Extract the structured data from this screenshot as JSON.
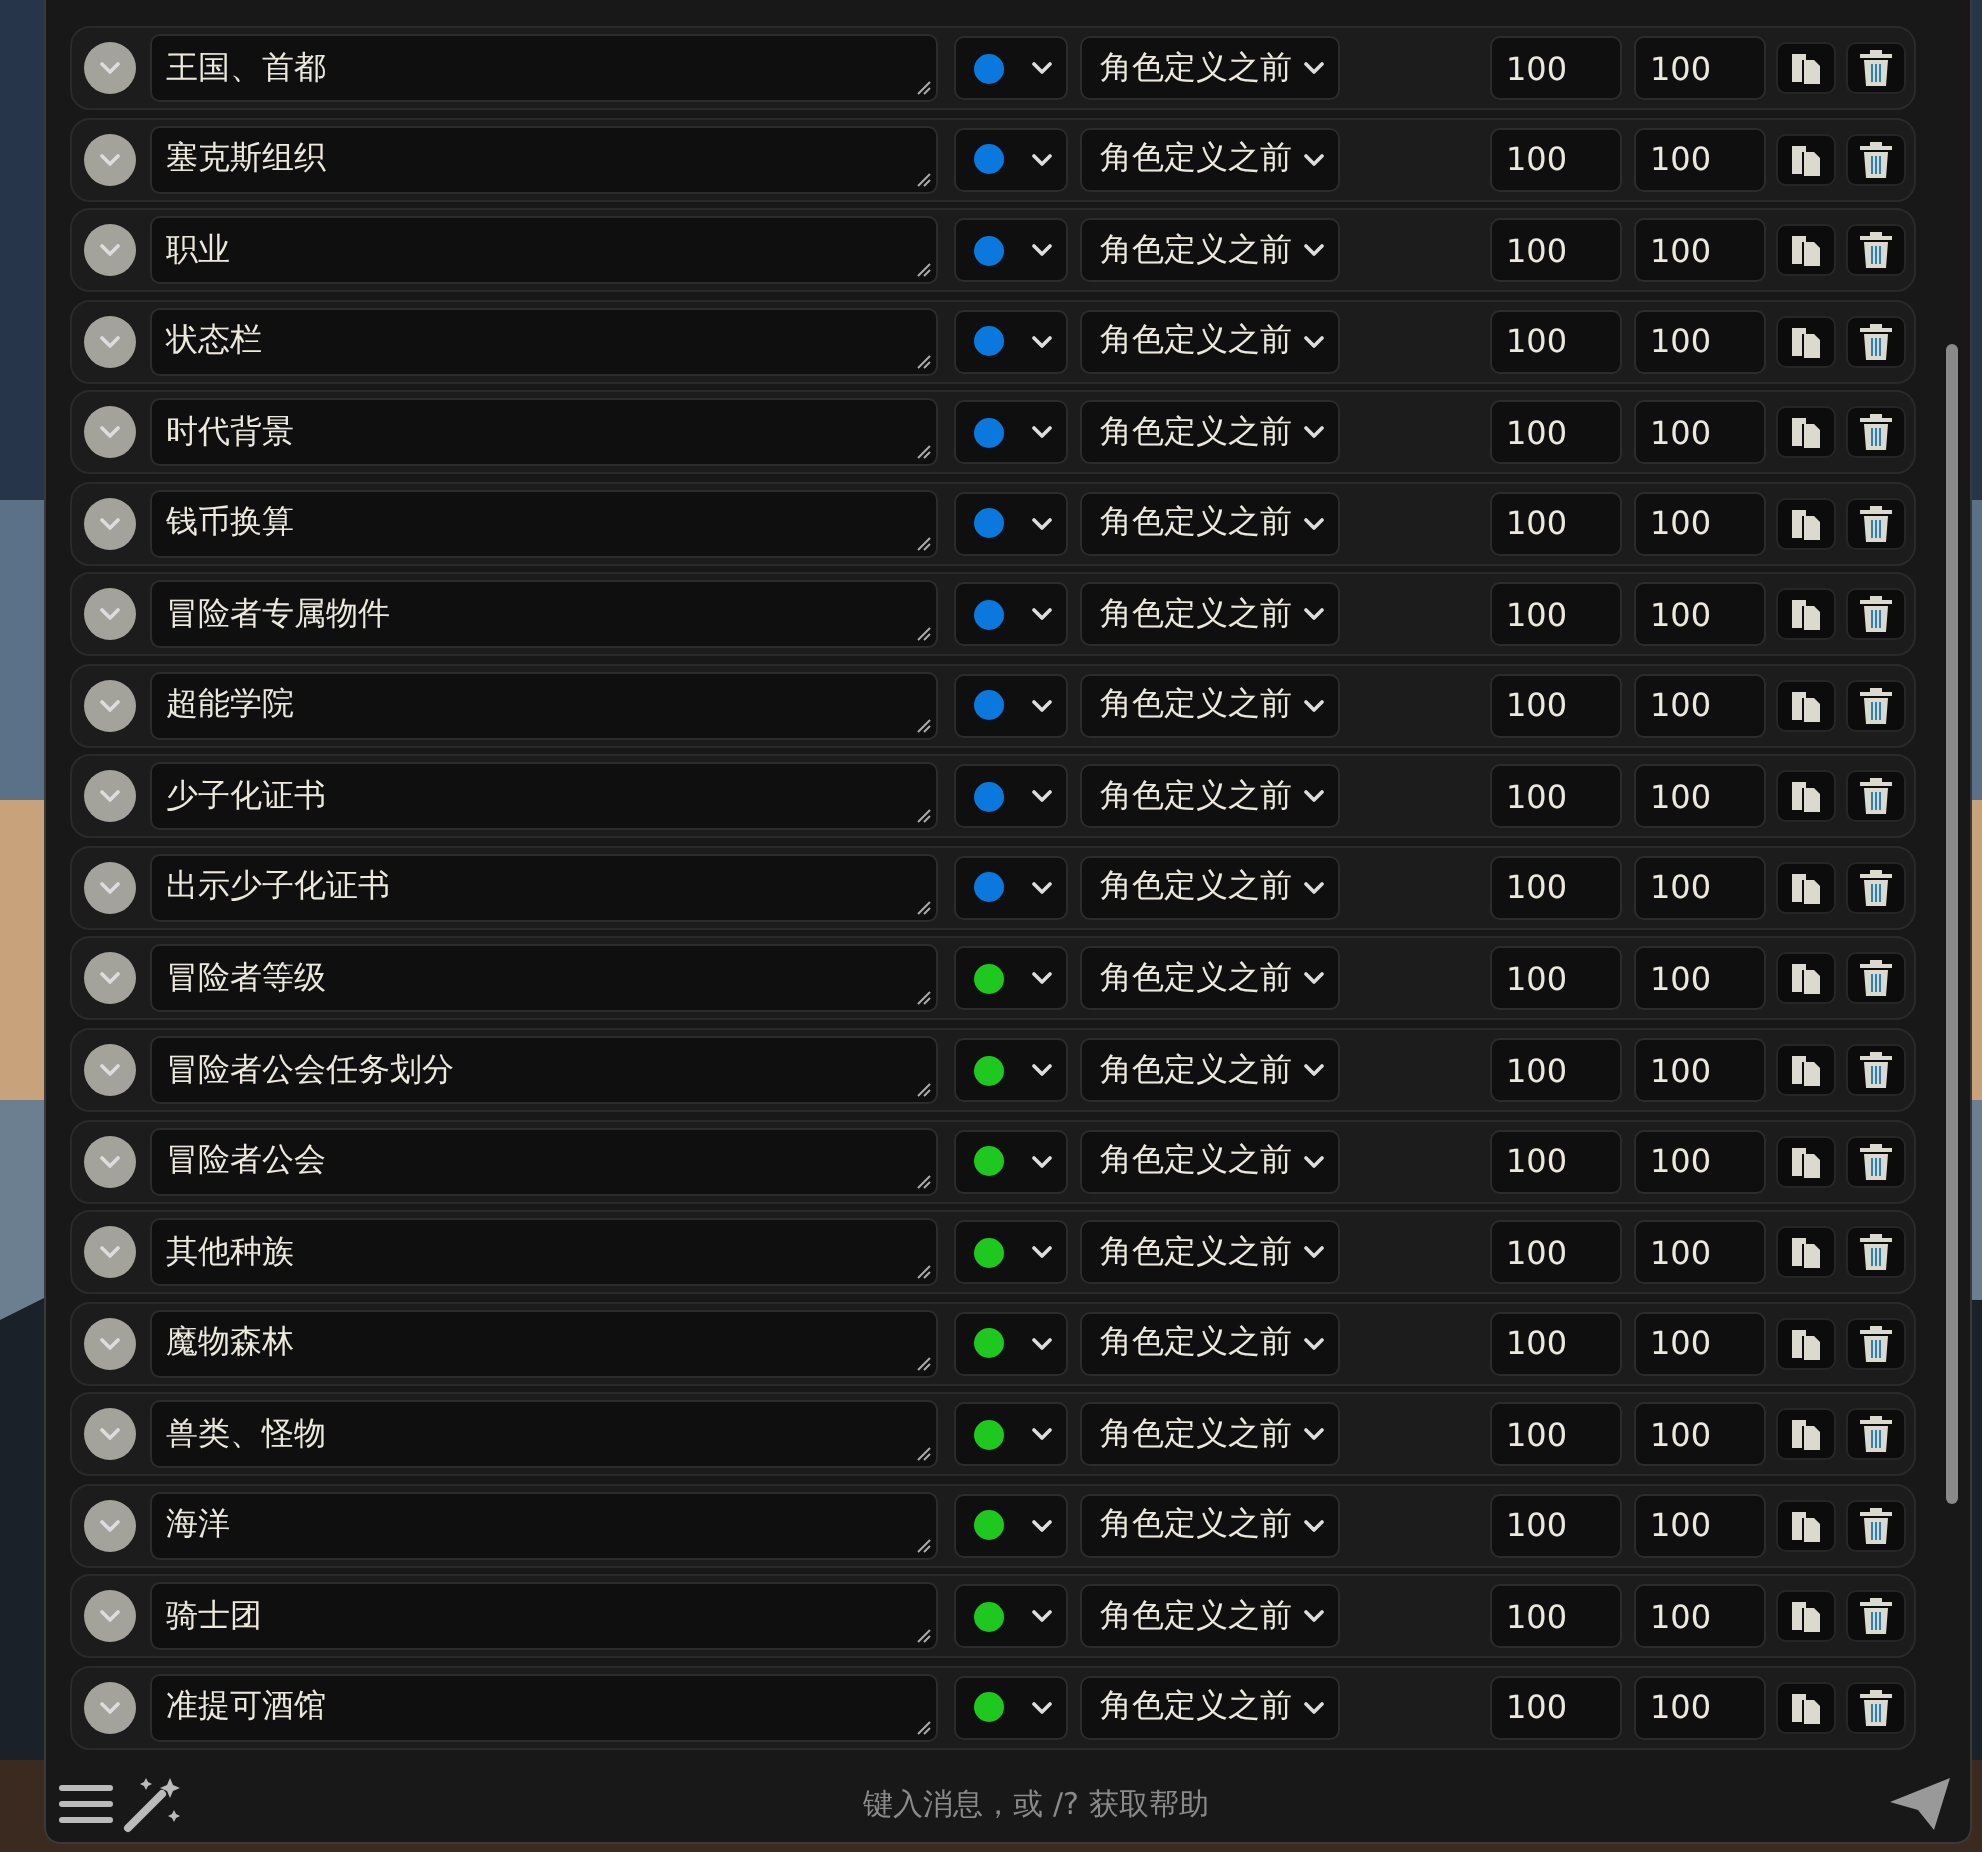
{
  "entries": [
    {
      "title": "王国、首都",
      "color": "#0a78dc",
      "position": "角色定义之前",
      "order": "100",
      "trigger": "100"
    },
    {
      "title": "塞克斯组织",
      "color": "#0a78dc",
      "position": "角色定义之前",
      "order": "100",
      "trigger": "100"
    },
    {
      "title": "职业",
      "color": "#0a78dc",
      "position": "角色定义之前",
      "order": "100",
      "trigger": "100"
    },
    {
      "title": "状态栏",
      "color": "#0a78dc",
      "position": "角色定义之前",
      "order": "100",
      "trigger": "100"
    },
    {
      "title": "时代背景",
      "color": "#0a78dc",
      "position": "角色定义之前",
      "order": "100",
      "trigger": "100"
    },
    {
      "title": "钱币换算",
      "color": "#0a78dc",
      "position": "角色定义之前",
      "order": "100",
      "trigger": "100"
    },
    {
      "title": "冒险者专属物件",
      "color": "#0a78dc",
      "position": "角色定义之前",
      "order": "100",
      "trigger": "100"
    },
    {
      "title": "超能学院",
      "color": "#0a78dc",
      "position": "角色定义之前",
      "order": "100",
      "trigger": "100"
    },
    {
      "title": "少子化证书",
      "color": "#0a78dc",
      "position": "角色定义之前",
      "order": "100",
      "trigger": "100"
    },
    {
      "title": "出示少子化证书",
      "color": "#0a78dc",
      "position": "角色定义之前",
      "order": "100",
      "trigger": "100"
    },
    {
      "title": "冒险者等级",
      "color": "#1ec81e",
      "position": "角色定义之前",
      "order": "100",
      "trigger": "100"
    },
    {
      "title": "冒险者公会任务划分",
      "color": "#1ec81e",
      "position": "角色定义之前",
      "order": "100",
      "trigger": "100"
    },
    {
      "title": "冒险者公会",
      "color": "#1ec81e",
      "position": "角色定义之前",
      "order": "100",
      "trigger": "100"
    },
    {
      "title": "其他种族",
      "color": "#1ec81e",
      "position": "角色定义之前",
      "order": "100",
      "trigger": "100"
    },
    {
      "title": "魔物森林",
      "color": "#1ec81e",
      "position": "角色定义之前",
      "order": "100",
      "trigger": "100"
    },
    {
      "title": "兽类、怪物",
      "color": "#1ec81e",
      "position": "角色定义之前",
      "order": "100",
      "trigger": "100"
    },
    {
      "title": "海洋",
      "color": "#1ec81e",
      "position": "角色定义之前",
      "order": "100",
      "trigger": "100"
    },
    {
      "title": "骑士团",
      "color": "#1ec81e",
      "position": "角色定义之前",
      "order": "100",
      "trigger": "100"
    },
    {
      "title": "准提可酒馆",
      "color": "#1ec81e",
      "position": "角色定义之前",
      "order": "100",
      "trigger": "100"
    }
  ],
  "composer": {
    "placeholder": "键入消息，或 /? 获取帮助"
  }
}
